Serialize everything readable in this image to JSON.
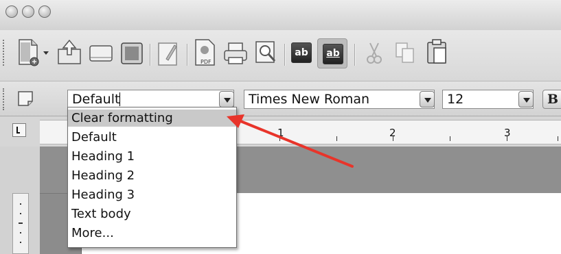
{
  "window": {
    "buttons": [
      "close",
      "minimize",
      "zoom"
    ]
  },
  "toolbar": {
    "icons": [
      "new-document-icon",
      "dropdown-arrow-icon",
      "open-folder-icon",
      "save-icon",
      "save-as-icon",
      "edit-file-icon",
      "export-pdf-icon",
      "print-icon",
      "page-preview-icon",
      "spelling-icon",
      "auto-spellcheck-icon",
      "cut-icon",
      "copy-icon",
      "paste-icon"
    ],
    "pdf_label": "PDF",
    "spell_label": "ab"
  },
  "format_bar": {
    "style_value": "Default",
    "font_value": "Times New Roman",
    "size_value": "12",
    "bold_label": "B"
  },
  "style_menu": {
    "items": [
      {
        "label": "Clear formatting",
        "selected": true
      },
      {
        "label": "Default",
        "selected": false
      },
      {
        "label": "Heading 1",
        "selected": false
      },
      {
        "label": "Heading 2",
        "selected": false
      },
      {
        "label": "Heading 3",
        "selected": false
      },
      {
        "label": "Text body",
        "selected": false
      },
      {
        "label": "More...",
        "selected": false
      }
    ]
  },
  "ruler": {
    "numbers": [
      "1",
      "2",
      "3"
    ]
  },
  "annotation": {
    "arrow_color": "#e8342a"
  }
}
